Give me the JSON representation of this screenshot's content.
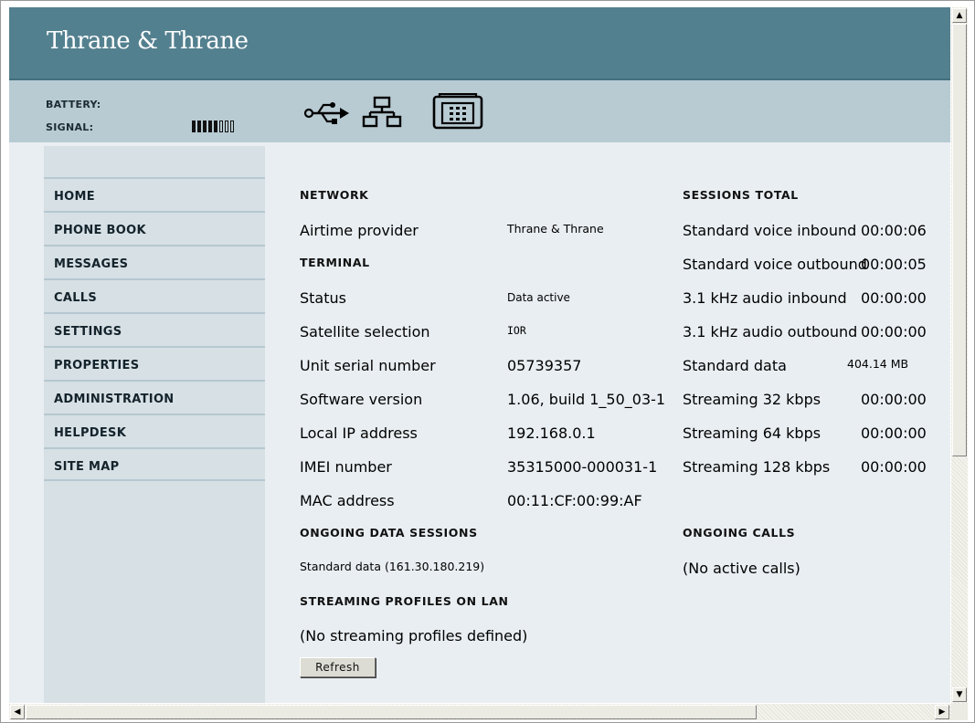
{
  "brand": "Thrane & Thrane",
  "status": {
    "battery_label": "BATTERY:",
    "signal_label": "SIGNAL:",
    "signal_level": 5,
    "signal_max": 8,
    "icons": [
      "usb-icon",
      "lan-icon",
      "telephone-icon"
    ]
  },
  "sidebar": {
    "items": [
      {
        "label": "HOME"
      },
      {
        "label": "PHONE BOOK"
      },
      {
        "label": "MESSAGES"
      },
      {
        "label": "CALLS"
      },
      {
        "label": "SETTINGS"
      },
      {
        "label": "PROPERTIES"
      },
      {
        "label": "ADMINISTRATION"
      },
      {
        "label": "HELPDESK"
      },
      {
        "label": "SITE MAP"
      }
    ]
  },
  "network": {
    "heading": "NETWORK",
    "airtime_label": "Airtime provider",
    "airtime_value": "Thrane & Thrane"
  },
  "terminal": {
    "heading": "TERMINAL",
    "rows": [
      {
        "label": "Status",
        "value": "Data active"
      },
      {
        "label": "Satellite selection",
        "value": "IOR"
      },
      {
        "label": "Unit serial number",
        "value": "05739357"
      },
      {
        "label": "Software version",
        "value": "1.06, build 1_50_03-1"
      },
      {
        "label": "Local IP address",
        "value": "192.168.0.1"
      },
      {
        "label": "IMEI number",
        "value": "35315000-000031-1"
      },
      {
        "label": "MAC address",
        "value": "00:11:CF:00:99:AF"
      }
    ]
  },
  "sessions": {
    "heading": "SESSIONS TOTAL",
    "rows": [
      {
        "label": "Standard voice inbound",
        "value": "00:00:06"
      },
      {
        "label": "Standard voice outbound",
        "value": "00:00:05"
      },
      {
        "label": "3.1 kHz audio inbound",
        "value": "00:00:00"
      },
      {
        "label": "3.1 kHz audio outbound",
        "value": "00:00:00"
      },
      {
        "label": "Standard data",
        "value": "404.14 MB"
      },
      {
        "label": "Streaming 32 kbps",
        "value": "00:00:00"
      },
      {
        "label": "Streaming 64 kbps",
        "value": "00:00:00"
      },
      {
        "label": "Streaming 128 kbps",
        "value": "00:00:00"
      }
    ]
  },
  "ongoing_data": {
    "heading": "ONGOING DATA SESSIONS",
    "text": "Standard data (161.30.180.219)"
  },
  "ongoing_calls": {
    "heading": "ONGOING CALLS",
    "text": "(No active calls)"
  },
  "streaming": {
    "heading": "STREAMING PROFILES ON LAN",
    "text": "(No streaming profiles defined)"
  },
  "refresh_label": "Refresh"
}
